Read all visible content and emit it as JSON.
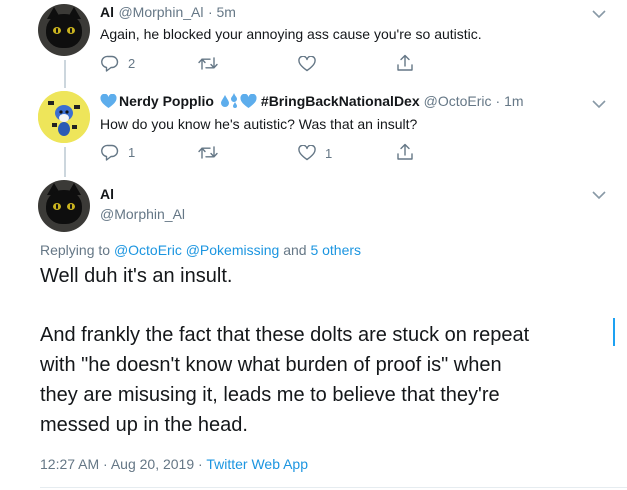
{
  "tweet1": {
    "name": "Al",
    "handle": "@Morphin_Al",
    "time": "· 5m",
    "text": "Again, he blocked your annoying ass cause you're so autistic.",
    "reply_count": "2",
    "retweet_count": "",
    "like_count": ""
  },
  "tweet2": {
    "name_part1": "Nerdy Popplio",
    "name_part2": "#BringBackNationalDex",
    "handle": "@OctoEric",
    "time": "· 1m",
    "text": "How do you know he's autistic? Was that an insult?",
    "reply_count": "1",
    "retweet_count": "",
    "like_count": "1"
  },
  "main_tweet": {
    "name": "Al",
    "handle": "@Morphin_Al",
    "replying_prefix": "Replying to",
    "replying_users": "@OctoEric @Pokemissing",
    "replying_and": "and",
    "replying_others": "5 others",
    "line1": "Well duh it's an insult.",
    "para_lines": [
      "And frankly the fact that these dolts are stuck on repeat",
      "with \"he doesn't know what burden of proof is\" when",
      "they are misusing it, leads me to believe that they're",
      "messed up in the head."
    ],
    "timestamp": "12:27 AM · Aug 20, 2019",
    "separator": "·",
    "source": "Twitter Web App"
  },
  "icons": {
    "chevron": "chevron-down-icon",
    "reply": "reply-icon",
    "retweet": "retweet-icon",
    "like": "heart-icon",
    "share": "share-icon",
    "emoji_heart": "blue-heart-icon",
    "emoji_splash": "sweat-droplets-icon"
  },
  "colors": {
    "link": "#1b95e0",
    "secondary": "#657786",
    "heart": "#5dadec"
  }
}
